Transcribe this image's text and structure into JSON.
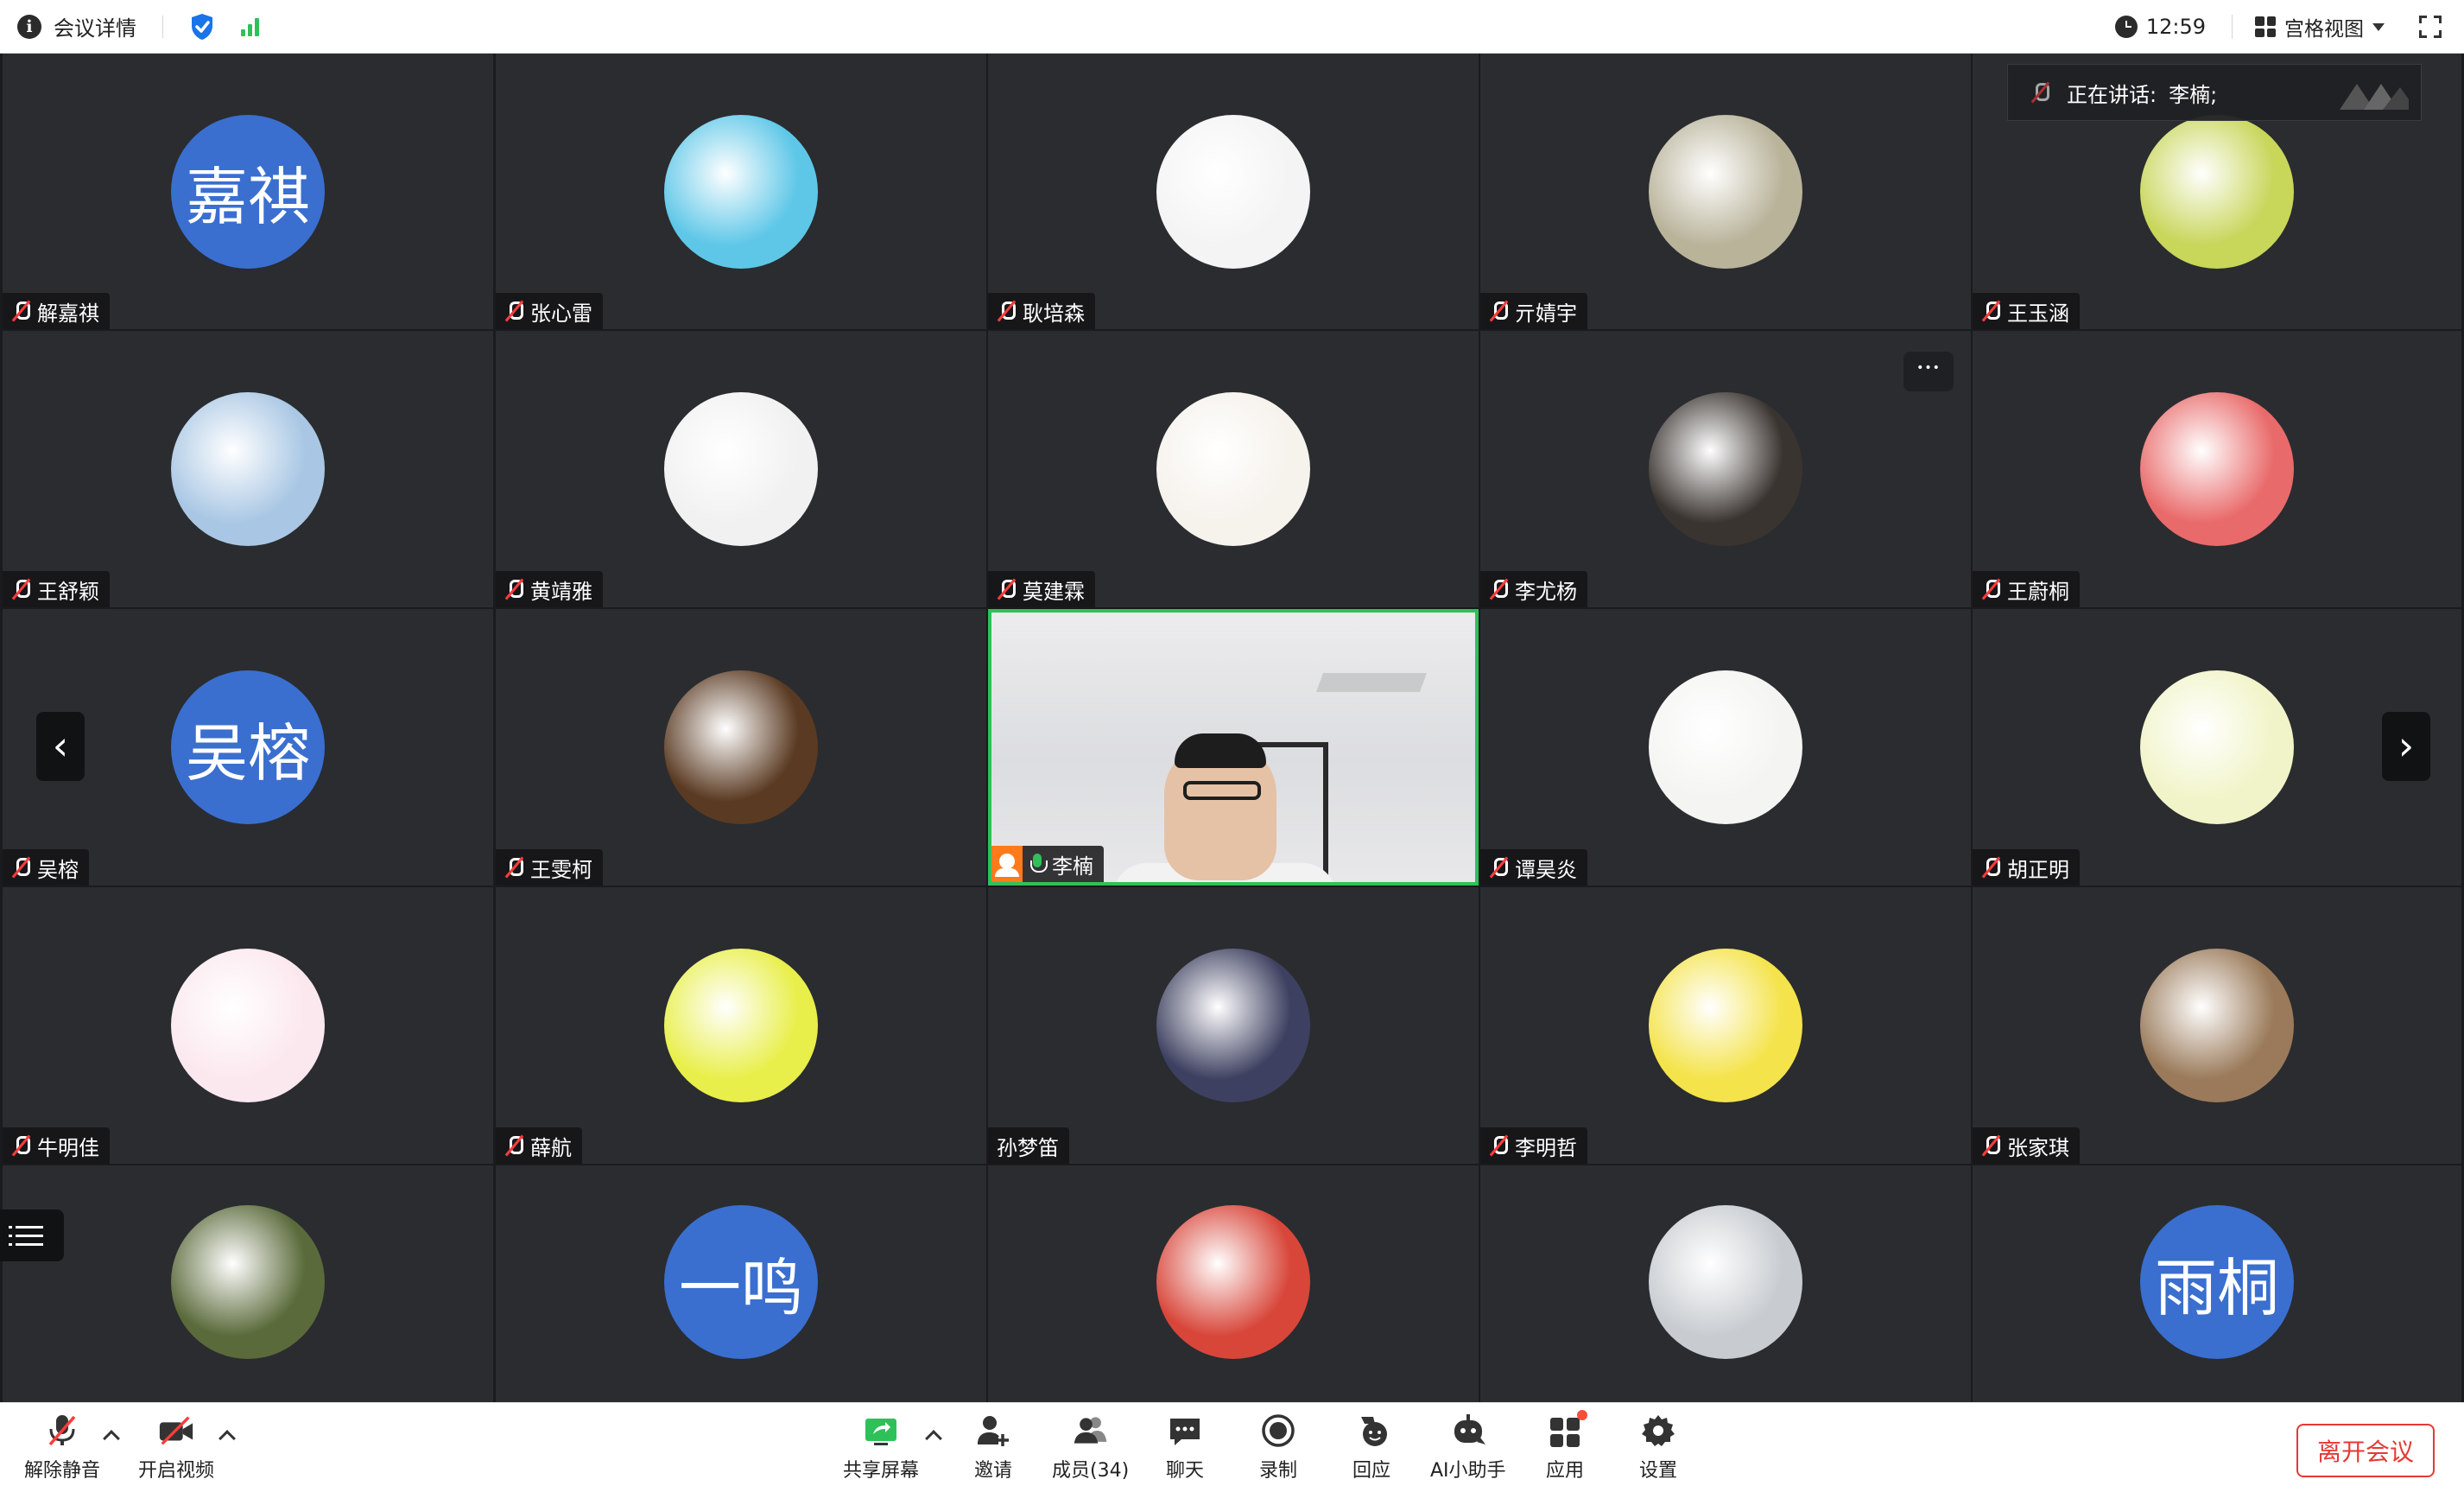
{
  "topbar": {
    "title": "会议详情",
    "time": "12:59",
    "view_label": "宫格视图"
  },
  "speaker": {
    "label": "正在讲话:",
    "name": "李楠;"
  },
  "tiles": [
    {
      "name": "解嘉祺",
      "muted": true,
      "avatar_text": "嘉祺",
      "avatar_color": "#3a6fd0"
    },
    {
      "name": "张心雷",
      "muted": true,
      "avatar_text": "",
      "avatar_color": "#5ec7e8"
    },
    {
      "name": "耿培森",
      "muted": true,
      "avatar_text": "",
      "avatar_color": "#f4f4f4"
    },
    {
      "name": "亓婧宇",
      "muted": true,
      "avatar_text": "",
      "avatar_color": "#b9b39a"
    },
    {
      "name": "王玉涵",
      "muted": true,
      "avatar_text": "",
      "avatar_color": "#c8d65a"
    },
    {
      "name": "王舒颖",
      "muted": true,
      "avatar_text": "",
      "avatar_color": "#a9c7e4"
    },
    {
      "name": "黄靖雅",
      "muted": true,
      "avatar_text": "",
      "avatar_color": "#f1f1f1"
    },
    {
      "name": "莫建霖",
      "muted": true,
      "avatar_text": "",
      "avatar_color": "#f6f2ec"
    },
    {
      "name": "李尤杨",
      "muted": true,
      "avatar_text": "",
      "avatar_color": "#3a3430"
    },
    {
      "name": "王蔚桐",
      "muted": true,
      "avatar_text": "",
      "avatar_color": "#e96a6a"
    },
    {
      "name": "吴榕",
      "muted": true,
      "avatar_text": "吴榕",
      "avatar_color": "#3a6fd0"
    },
    {
      "name": "王雯柯",
      "muted": true,
      "avatar_text": "",
      "avatar_color": "#5a3a22"
    },
    {
      "name": "李楠",
      "muted": false,
      "host": true,
      "video": true
    },
    {
      "name": "谭昊炎",
      "muted": true,
      "avatar_text": "",
      "avatar_color": "#f4f4f2"
    },
    {
      "name": "胡正明",
      "muted": true,
      "avatar_text": "",
      "avatar_color": "#f1f4c8"
    },
    {
      "name": "牛明佳",
      "muted": true,
      "avatar_text": "",
      "avatar_color": "#fbe8ee"
    },
    {
      "name": "薛航",
      "muted": true,
      "avatar_text": "",
      "avatar_color": "#e8ef4a"
    },
    {
      "name": "孙梦笛",
      "muted": false,
      "nomic": true,
      "avatar_text": "",
      "avatar_color": "#3d4060"
    },
    {
      "name": "李明哲",
      "muted": true,
      "avatar_text": "",
      "avatar_color": "#f4e34a"
    },
    {
      "name": "张家琪",
      "muted": true,
      "avatar_text": "",
      "avatar_color": "#9a7a5a"
    },
    {
      "name": "",
      "avatar_text": "",
      "avatar_color": "#5a6a3a",
      "partial": true
    },
    {
      "name": "",
      "avatar_text": "一鸣",
      "avatar_color": "#3a6fd0",
      "partial": true
    },
    {
      "name": "",
      "avatar_text": "",
      "avatar_color": "#d8463a",
      "partial": true
    },
    {
      "name": "",
      "avatar_text": "",
      "avatar_color": "#c8ccd0",
      "partial": true
    },
    {
      "name": "",
      "avatar_text": "雨桐",
      "avatar_color": "#3a6fd0",
      "partial": true
    }
  ],
  "toolbar": {
    "unmute": "解除静音",
    "start_video": "开启视频",
    "share_screen": "共享屏幕",
    "invite": "邀请",
    "members": "成员(34)",
    "chat": "聊天",
    "record": "录制",
    "react": "回应",
    "ai_assistant": "AI小助手",
    "apps": "应用",
    "settings": "设置",
    "leave": "离开会议"
  },
  "icons": {
    "more": "more-icon",
    "prev": "chevron-left-icon",
    "next": "chevron-right-icon",
    "list": "list-icon"
  }
}
